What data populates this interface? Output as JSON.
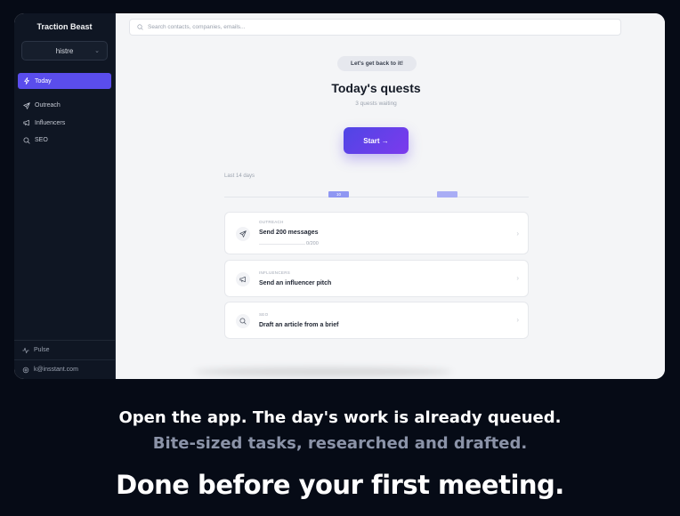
{
  "app": {
    "brand": "Traction Beast",
    "workspace": "histre"
  },
  "sidebar": {
    "items": [
      {
        "label": "Today",
        "icon": "bolt-icon",
        "active": true
      },
      {
        "label": "Outreach",
        "icon": "send-icon"
      },
      {
        "label": "Influencers",
        "icon": "megaphone-icon"
      },
      {
        "label": "SEO",
        "icon": "search-icon"
      }
    ],
    "pulse": "Pulse",
    "account": "k@insstant.com"
  },
  "search": {
    "placeholder": "Search contacts, companies, emails..."
  },
  "main": {
    "pill": "Let's get back to it!",
    "title": "Today's quests",
    "subtitle": "3 quests waiting",
    "start_label": "Start →",
    "chart_label": "Last 14 days",
    "chart": {
      "bars": [
        {
          "index": 5,
          "value": 1,
          "label": "10",
          "highlight": true
        },
        {
          "index": 10,
          "value": 1,
          "label": "",
          "highlight": false
        }
      ],
      "days": 14
    },
    "quests": [
      {
        "category": "OUTREACH",
        "task": "Send 200 messages",
        "progress": "0/200",
        "icon": "send-icon"
      },
      {
        "category": "INFLUENCERS",
        "task": "Send an influencer pitch",
        "icon": "megaphone-icon"
      },
      {
        "category": "SEO",
        "task": "Draft an article from a brief",
        "icon": "search-icon"
      }
    ]
  },
  "captions": {
    "line1": "Open the app. The day's work is already queued.",
    "line2": "Bite-sized tasks, researched and drafted.",
    "line3": "Done before your first meeting."
  },
  "colors": {
    "accent": "#5a4dec",
    "sidebar_bg": "#0f1623",
    "page_bg": "#060b16"
  }
}
